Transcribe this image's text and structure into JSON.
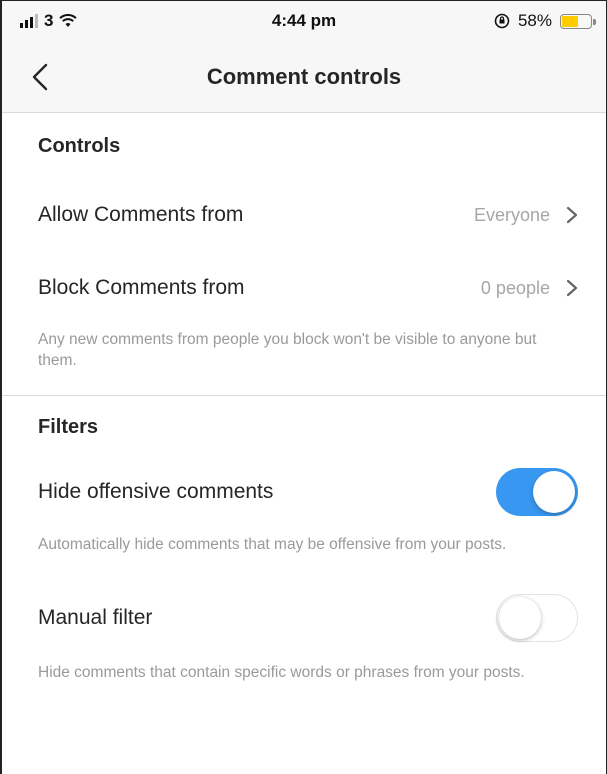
{
  "status_bar": {
    "carrier": "3",
    "time": "4:44 pm",
    "battery_percent": "58%",
    "battery_level": 0.58,
    "battery_color": "#ffcc00"
  },
  "nav": {
    "title": "Comment controls",
    "back_icon": "chevron-left-icon"
  },
  "controls": {
    "header": "Controls",
    "allow_label": "Allow Comments from",
    "allow_value": "Everyone",
    "block_label": "Block Comments from",
    "block_value": "0 people",
    "block_desc": "Any new comments from people you block won't be visible to anyone but them."
  },
  "filters": {
    "header": "Filters",
    "hide_offensive_label": "Hide offensive comments",
    "hide_offensive_on": true,
    "hide_offensive_desc": "Automatically hide comments that may be offensive from your posts.",
    "manual_label": "Manual filter",
    "manual_on": false,
    "manual_desc": "Hide comments that contain specific words or phrases from your posts."
  },
  "colors": {
    "accent": "#3897f0",
    "secondary_text": "#9a9a9a"
  }
}
